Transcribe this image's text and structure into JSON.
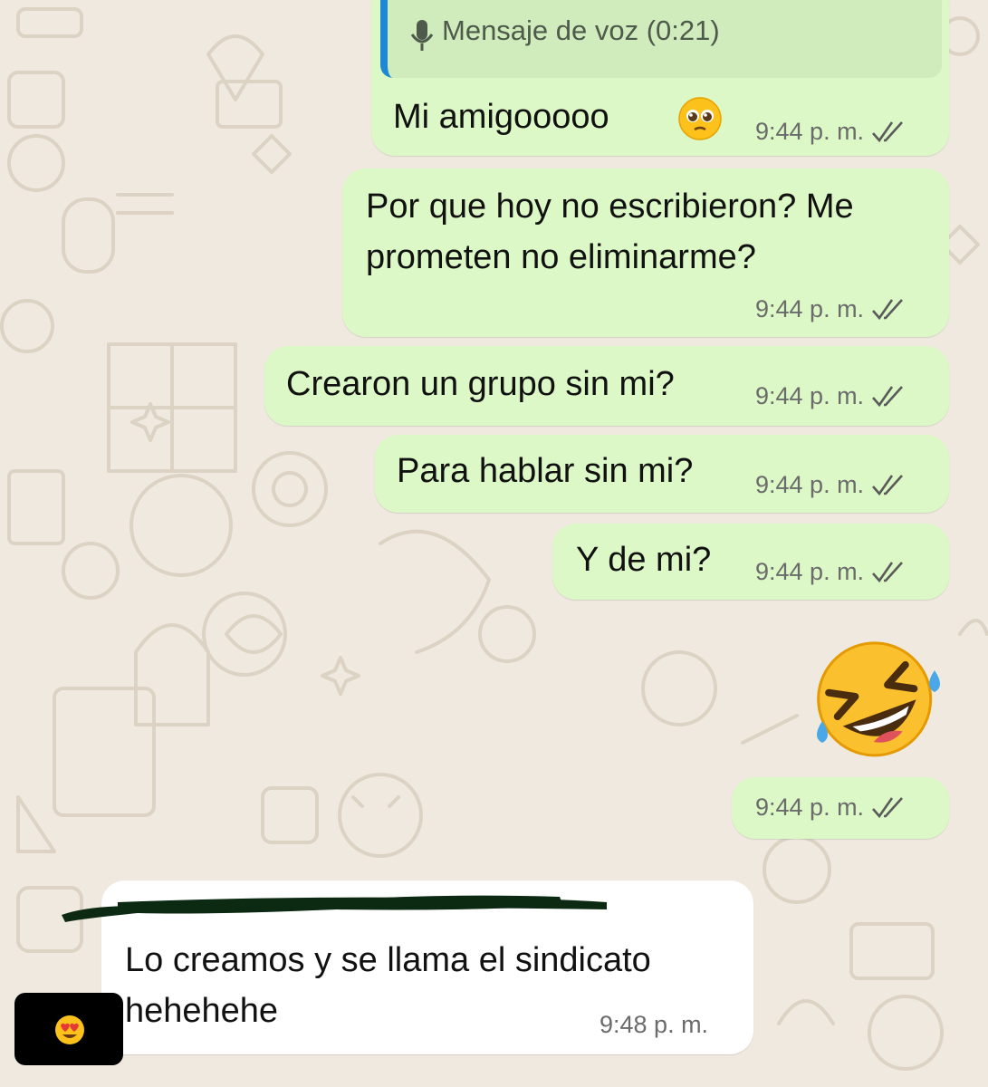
{
  "colors": {
    "outgoing_bubble": "#dcf8c6",
    "incoming_bubble": "#ffffff",
    "background": "#efe9df",
    "quote_bar": "#1e88d4",
    "ticks": "#5a5a5a"
  },
  "quoted": {
    "icon": "microphone-icon",
    "text": "Mensaje de voz (0:21)"
  },
  "messages": [
    {
      "text": "Mi amigooooo",
      "emoji": "pleading-face-emoji",
      "time": "9:44 p. m.",
      "status": "double-check-icon"
    },
    {
      "line1": "Por que hoy no escribieron? Me",
      "line2": "prometen no eliminarme?",
      "time": "9:44 p. m.",
      "status": "double-check-icon"
    },
    {
      "text": "Crearon un grupo sin mi?",
      "time": "9:44 p. m.",
      "status": "double-check-icon"
    },
    {
      "text": "Para hablar sin mi?",
      "time": "9:44 p. m.",
      "status": "double-check-icon"
    },
    {
      "text": "Y de mi?",
      "time": "9:44 p. m.",
      "status": "double-check-icon"
    },
    {
      "emoji": "rolling-on-floor-laughing-emoji",
      "time": "9:44 p. m.",
      "status": "double-check-icon"
    }
  ],
  "incoming": {
    "sender": "redacted-sender-name",
    "line1": "Lo creamos y se llama el sindicato",
    "line2": "hehehehe",
    "time": "9:48 p. m.",
    "reaction": "heart-eyes-emoji"
  }
}
